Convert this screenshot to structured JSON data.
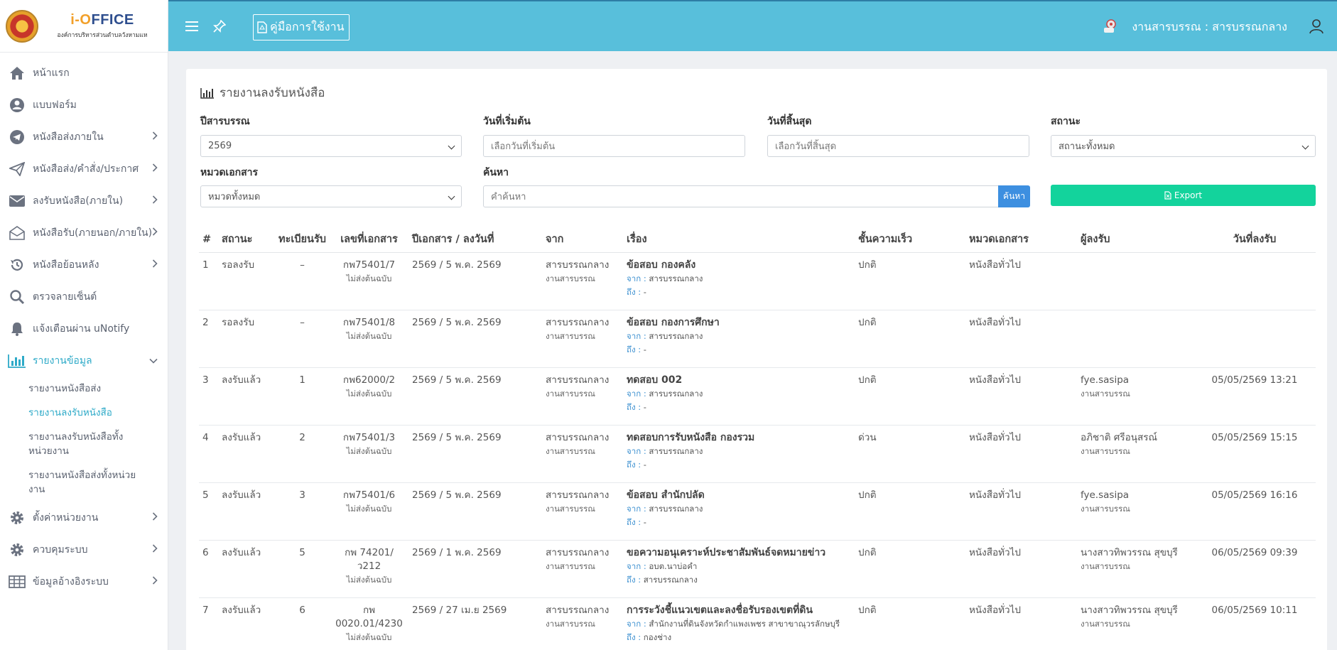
{
  "brand": {
    "title_i": "i-O",
    "title_rest": "FFICE",
    "subtitle": "องค์การบริหารส่วนตำบลวังหามแห"
  },
  "sidebar": {
    "items": [
      {
        "label": "หน้าแรก",
        "icon": "home-icon",
        "has_chevron": false
      },
      {
        "label": "แบบฟอร์ม",
        "icon": "user-circle-icon",
        "has_chevron": false
      },
      {
        "label": "หนังสือส่งภายใน",
        "icon": "telegram-icon",
        "has_chevron": true
      },
      {
        "label": "หนังสือส่ง/คำสั่ง/ประกาศ",
        "icon": "paper-plane-icon",
        "has_chevron": true
      },
      {
        "label": "ลงรับหนังสือ(ภายใน)",
        "icon": "envelope-icon",
        "has_chevron": true
      },
      {
        "label": "หนังสือรับ(ภายนอก/ภายใน)",
        "icon": "envelope-open-icon",
        "has_chevron": true
      },
      {
        "label": "หนังสือย้อนหลัง",
        "icon": "history-icon",
        "has_chevron": true
      },
      {
        "label": "ตรวจลายเซ็นต์",
        "icon": "search-icon",
        "has_chevron": false
      },
      {
        "label": "แจ้งเตือนผ่าน uNotify",
        "icon": "bell-icon",
        "has_chevron": false
      },
      {
        "label": "รายงานข้อมูล",
        "icon": "bar-chart-icon",
        "has_chevron": true,
        "active": true
      }
    ],
    "report_sub": [
      "รายงานหนังสือส่ง",
      "รายงานลงรับหนังสือ",
      "รายงานลงรับหนังสือทั้งหน่วยงาน",
      "รายงานหนังสือส่งทั้งหน่วยงาน"
    ],
    "report_sub_active": 1,
    "bottom_items": [
      {
        "label": "ตั้งค่าหน่วยงาน",
        "icon": "gear-icon"
      },
      {
        "label": "ควบคุมระบบ",
        "icon": "gear-icon"
      },
      {
        "label": "ข้อมูลอ้างอิงระบบ",
        "icon": "table-icon"
      }
    ]
  },
  "topbar": {
    "manual_label": "คู่มือการใช้งาน",
    "user_label": "งานสารบรรณ : สารบรรณกลาง"
  },
  "page": {
    "title": "รายงานลงรับหนังสือ",
    "filters": {
      "year_label": "ปีสารบรรณ",
      "year_value": "2569",
      "start_label": "วันที่เริ่มต้น",
      "start_placeholder": "เลือกวันที่เริ่มต้น",
      "end_label": "วันที่สิ้นสุด",
      "end_placeholder": "เลือกวันที่สิ้นสุด",
      "status_label": "สถานะ",
      "status_value": "สถานะทั้งหมด",
      "category_label": "หมวดเอกสาร",
      "category_value": "หมวดทั้งหมด",
      "search_label": "ค้นหา",
      "search_placeholder": "คำค้นหา",
      "search_button": "ค้นหา",
      "export_button": "Export"
    }
  },
  "table": {
    "headers": [
      "#",
      "สถานะ",
      "ทะเบียนรับ",
      "เลขที่เอกสาร",
      "ปีเอกสาร / ลงวันที่",
      "จาก",
      "เรื่อง",
      "ชั้นความเร็ว",
      "หมวดเอกสาร",
      "ผู้ลงรับ",
      "วันที่ลงรับ"
    ],
    "from_label": "จาก :",
    "to_label": "ถึง :",
    "rows": [
      {
        "no": "1",
        "status": "รอลงรับ",
        "reg": "–",
        "doc": "กพ75401/7",
        "doc_note": "ไม่ส่งต้นฉบับ",
        "date": "2569 / 5 พ.ค. 2569",
        "from": "สารบรรณกลาง",
        "from_unit": "งานสารบรรณ",
        "subject": "ข้อสอบ กองคลัง",
        "subj_from": "สารบรรณกลาง",
        "subj_to": "-",
        "speed": "ปกติ",
        "category": "หนังสือทั่วไป",
        "receiver": "",
        "receiver_unit": "",
        "received_at": ""
      },
      {
        "no": "2",
        "status": "รอลงรับ",
        "reg": "–",
        "doc": "กพ75401/8",
        "doc_note": "ไม่ส่งต้นฉบับ",
        "date": "2569 / 5 พ.ค. 2569",
        "from": "สารบรรณกลาง",
        "from_unit": "งานสารบรรณ",
        "subject": "ข้อสอบ กองการศึกษา",
        "subj_from": "สารบรรณกลาง",
        "subj_to": "-",
        "speed": "ปกติ",
        "category": "หนังสือทั่วไป",
        "receiver": "",
        "receiver_unit": "",
        "received_at": ""
      },
      {
        "no": "3",
        "status": "ลงรับแล้ว",
        "reg": "1",
        "doc": "กพ62000/2",
        "doc_note": "ไม่ส่งต้นฉบับ",
        "date": "2569 / 5 พ.ค. 2569",
        "from": "สารบรรณกลาง",
        "from_unit": "งานสารบรรณ",
        "subject": "ทดสอบ 002",
        "subj_from": "สารบรรณกลาง",
        "subj_to": "-",
        "speed": "ปกติ",
        "category": "หนังสือทั่วไป",
        "receiver": "fye.sasipa",
        "receiver_unit": "งานสารบรรณ",
        "received_at": "05/05/2569 13:21"
      },
      {
        "no": "4",
        "status": "ลงรับแล้ว",
        "reg": "2",
        "doc": "กพ75401/3",
        "doc_note": "ไม่ส่งต้นฉบับ",
        "date": "2569 / 5 พ.ค. 2569",
        "from": "สารบรรณกลาง",
        "from_unit": "งานสารบรรณ",
        "subject": "ทดสอบการรับหนังสือ กองรวม",
        "subj_from": "สารบรรณกลาง",
        "subj_to": "-",
        "speed": "ด่วน",
        "category": "หนังสือทั่วไป",
        "receiver": "อภิชาติ ศรีอนุสรณ์",
        "receiver_unit": "งานสารบรรณ",
        "received_at": "05/05/2569 15:15"
      },
      {
        "no": "5",
        "status": "ลงรับแล้ว",
        "reg": "3",
        "doc": "กพ75401/6",
        "doc_note": "ไม่ส่งต้นฉบับ",
        "date": "2569 / 5 พ.ค. 2569",
        "from": "สารบรรณกลาง",
        "from_unit": "งานสารบรรณ",
        "subject": "ข้อสอบ สำนักปลัด",
        "subj_from": "สารบรรณกลาง",
        "subj_to": "-",
        "speed": "ปกติ",
        "category": "หนังสือทั่วไป",
        "receiver": "fye.sasipa",
        "receiver_unit": "งานสารบรรณ",
        "received_at": "05/05/2569 16:16"
      },
      {
        "no": "6",
        "status": "ลงรับแล้ว",
        "reg": "5",
        "doc": "กพ 74201/ว212",
        "doc_note": "ไม่ส่งต้นฉบับ",
        "date": "2569 / 1 พ.ค. 2569",
        "from": "สารบรรณกลาง",
        "from_unit": "งานสารบรรณ",
        "subject": "ขอความอนุเคราะห์ประชาสัมพันธ์จดหมายข่าว",
        "subj_from": "อบต.นาบ่อคำ",
        "subj_to": "สารบรรณกลาง",
        "speed": "ปกติ",
        "category": "หนังสือทั่วไป",
        "receiver": "นางสาวทิพวรรณ สุขบุรี",
        "receiver_unit": "งานสารบรรณ",
        "received_at": "06/05/2569 09:39"
      },
      {
        "no": "7",
        "status": "ลงรับแล้ว",
        "reg": "6",
        "doc": "กพ 0020.01/4230",
        "doc_note": "ไม่ส่งต้นฉบับ",
        "date": "2569 / 27 เม.ย 2569",
        "from": "สารบรรณกลาง",
        "from_unit": "งานสารบรรณ",
        "subject": "การระวังชี้แนวเขตและลงชื่อรับรองเขตที่ดิน",
        "subj_from": "สำนักงานที่ดินจังหวัดกำแพงเพชร สาขาขาณุวรลักษบุรี",
        "subj_to": "กองช่าง",
        "speed": "ปกติ",
        "category": "หนังสือทั่วไป",
        "receiver": "นางสาวทิพวรรณ สุขบุรี",
        "receiver_unit": "งานสารบรรณ",
        "received_at": "06/05/2569 10:11"
      }
    ]
  }
}
